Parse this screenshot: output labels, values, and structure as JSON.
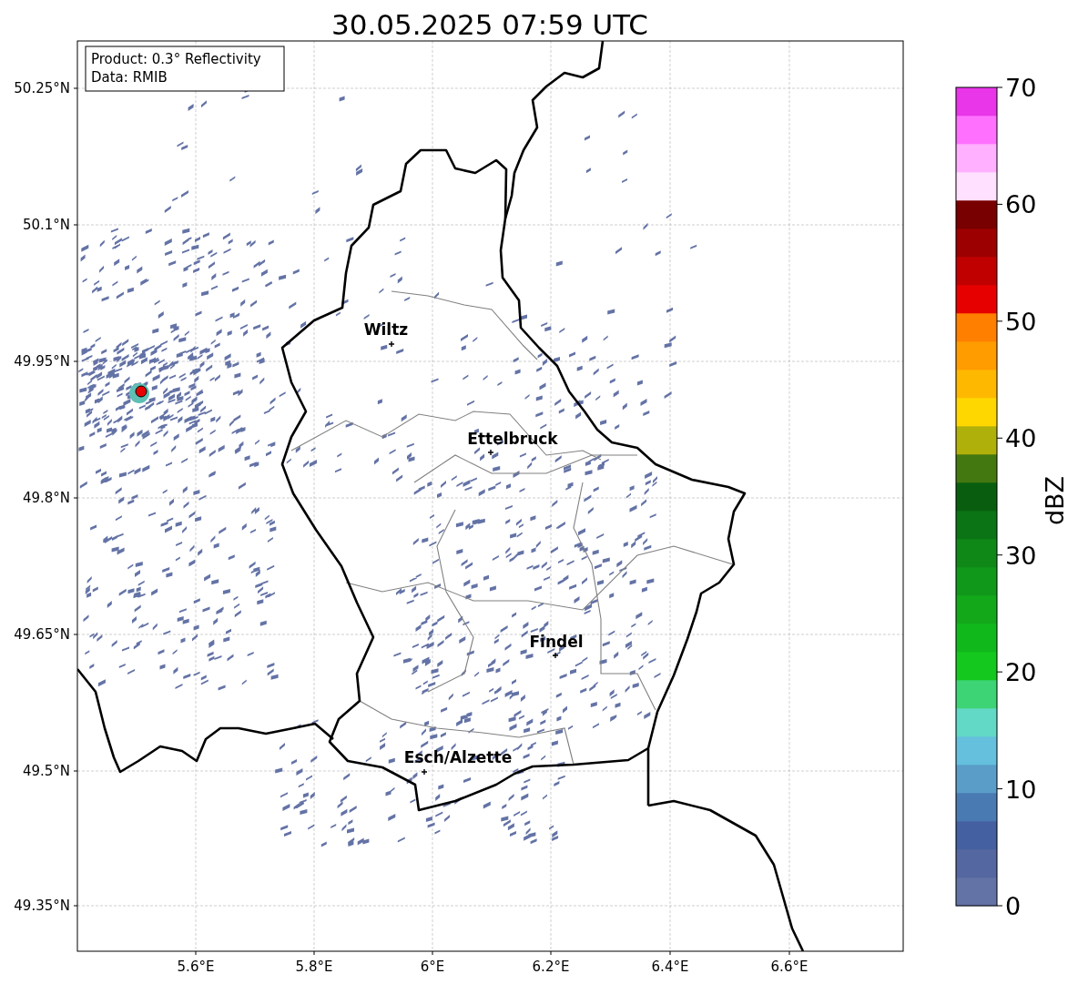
{
  "title": "30.05.2025 07:59 UTC",
  "info_box": {
    "lines": [
      "Product: 0.3° Reflectivity",
      "Data: RMIB"
    ]
  },
  "y_ticks": [
    "50.25°N",
    "50.1°N",
    "49.95°N",
    "49.8°N",
    "49.65°N",
    "49.5°N",
    "49.35°N"
  ],
  "x_ticks": [
    "5.6°E",
    "5.8°E",
    "6°E",
    "6.2°E",
    "6.4°E",
    "6.6°E"
  ],
  "cities": [
    {
      "name": "Wiltz"
    },
    {
      "name": "Ettelbruck"
    },
    {
      "name": "Findel"
    },
    {
      "name": "Esch/Alzette"
    }
  ],
  "colorbar": {
    "label": "dBZ",
    "ticks": [
      "70",
      "60",
      "50",
      "40",
      "30",
      "20",
      "10",
      "0"
    ]
  }
}
